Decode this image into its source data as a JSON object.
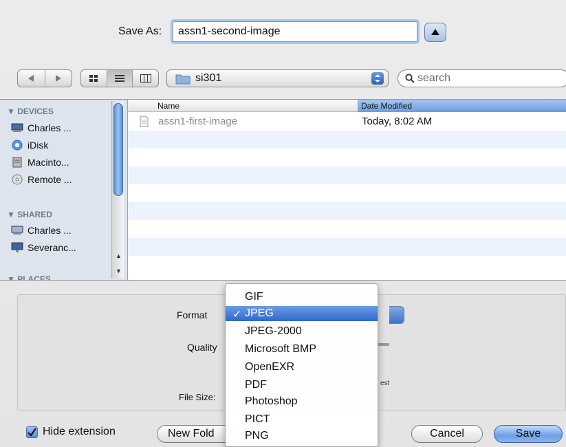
{
  "dialog": {
    "save_as_label": "Save As:",
    "filename": "assn1-second-image"
  },
  "toolbar": {
    "current_folder": "si301",
    "search_placeholder": "search"
  },
  "sidebar": {
    "devices_header": "DEVICES",
    "devices": [
      {
        "label": "Charles ...",
        "icon": "computer-icon"
      },
      {
        "label": "iDisk",
        "icon": "idisk-icon"
      },
      {
        "label": "Macinto...",
        "icon": "hard-drive-icon"
      },
      {
        "label": "Remote ...",
        "icon": "remote-disc-icon"
      }
    ],
    "shared_header": "SHARED",
    "shared": [
      {
        "label": "Charles ...",
        "icon": "shared-computer-icon"
      },
      {
        "label": "Severanc...",
        "icon": "display-icon"
      }
    ],
    "places_header": "PLACES"
  },
  "file_list": {
    "columns": {
      "name": "Name",
      "date": "Date Modified"
    },
    "rows": [
      {
        "name": "assn1-first-image",
        "date": "Today, 8:02 AM"
      }
    ]
  },
  "options": {
    "format_label": "Format",
    "quality_label": "Quality",
    "quality_partial": "est",
    "file_size_label": "File Size:"
  },
  "format_menu": {
    "selected": "JPEG",
    "items": [
      "GIF",
      "JPEG",
      "JPEG-2000",
      "Microsoft BMP",
      "OpenEXR",
      "PDF",
      "Photoshop",
      "PICT",
      "PNG"
    ]
  },
  "bottom": {
    "hide_extension_label": "Hide extension",
    "hide_extension_checked": true,
    "new_folder_label": "New Fold",
    "cancel_label": "Cancel",
    "save_label": "Save"
  },
  "colors": {
    "accent": "#3f73c7",
    "sidebar_bg": "#dde4ee",
    "row_alt": "#edf3fe"
  }
}
